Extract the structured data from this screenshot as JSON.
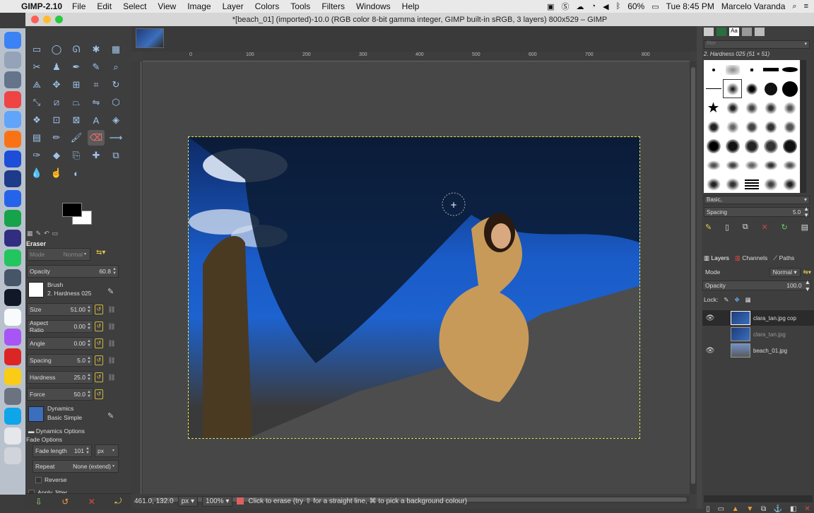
{
  "menubar": {
    "app_name": "GIMP-2.10",
    "items": [
      "File",
      "Edit",
      "Select",
      "View",
      "Image",
      "Layer",
      "Colors",
      "Tools",
      "Filters",
      "Windows",
      "Help"
    ],
    "battery": "60%",
    "clock": "Tue 8:45 PM",
    "user": "Marcelo Varanda"
  },
  "window": {
    "title": "*[beach_01] (imported)-10.0 (RGB color 8-bit gamma integer, GIMP built-in sRGB, 3 layers) 800x529 – GIMP"
  },
  "toolbox": {
    "tool_options_title": "Eraser",
    "mode_label": "Mode",
    "mode_value": "Normal",
    "opacity_label": "Opacity",
    "opacity_value": "60.8",
    "brush_label": "Brush",
    "brush_value": "2. Hardness 025",
    "size_label": "Size",
    "size_value": "51.00",
    "aspect_label": "Aspect Ratio",
    "aspect_value": "0.00",
    "angle_label": "Angle",
    "angle_value": "0.00",
    "spacing_label": "Spacing",
    "spacing_value": "5.0",
    "hardness_label": "Hardness",
    "hardness_value": "25.0",
    "force_label": "Force",
    "force_value": "50.0",
    "dynamics_label": "Dynamics",
    "dynamics_value": "Basic Simple",
    "dynamics_options": "Dynamics Options",
    "fade_options": "Fade Options",
    "fade_length_label": "Fade length",
    "fade_length_value": "101",
    "fade_unit": "px",
    "repeat_label": "Repeat",
    "repeat_value": "None (extend)",
    "reverse_label": "Reverse",
    "apply_jitter_label": "Apply Jitter"
  },
  "status": {
    "coords": "461.0, 132.0",
    "unit": "px",
    "zoom": "100%",
    "message": "Click to erase (try ⇧ for a straight line, ⌘ to pick a background colour)"
  },
  "ruler": {
    "ticks": [
      "0",
      "100",
      "200",
      "300",
      "400",
      "500",
      "600",
      "700",
      "800"
    ]
  },
  "brushes": {
    "filter_placeholder": "filter",
    "selected_brush": "2. Hardness 025 (51 × 51)",
    "preset": "Basic,",
    "spacing_label": "Spacing",
    "spacing_value": "5.0"
  },
  "layers": {
    "tabs": [
      "Layers",
      "Channels",
      "Paths"
    ],
    "mode_label": "Mode",
    "mode_value": "Normal",
    "opacity_label": "Opacity",
    "opacity_value": "100.0",
    "lock_label": "Lock:",
    "rows": [
      {
        "name": "clara_tan.jpg cop",
        "visible": true
      },
      {
        "name": "clara_tan.jpg",
        "visible": false
      },
      {
        "name": "beach_01.jpg",
        "visible": true
      }
    ]
  }
}
